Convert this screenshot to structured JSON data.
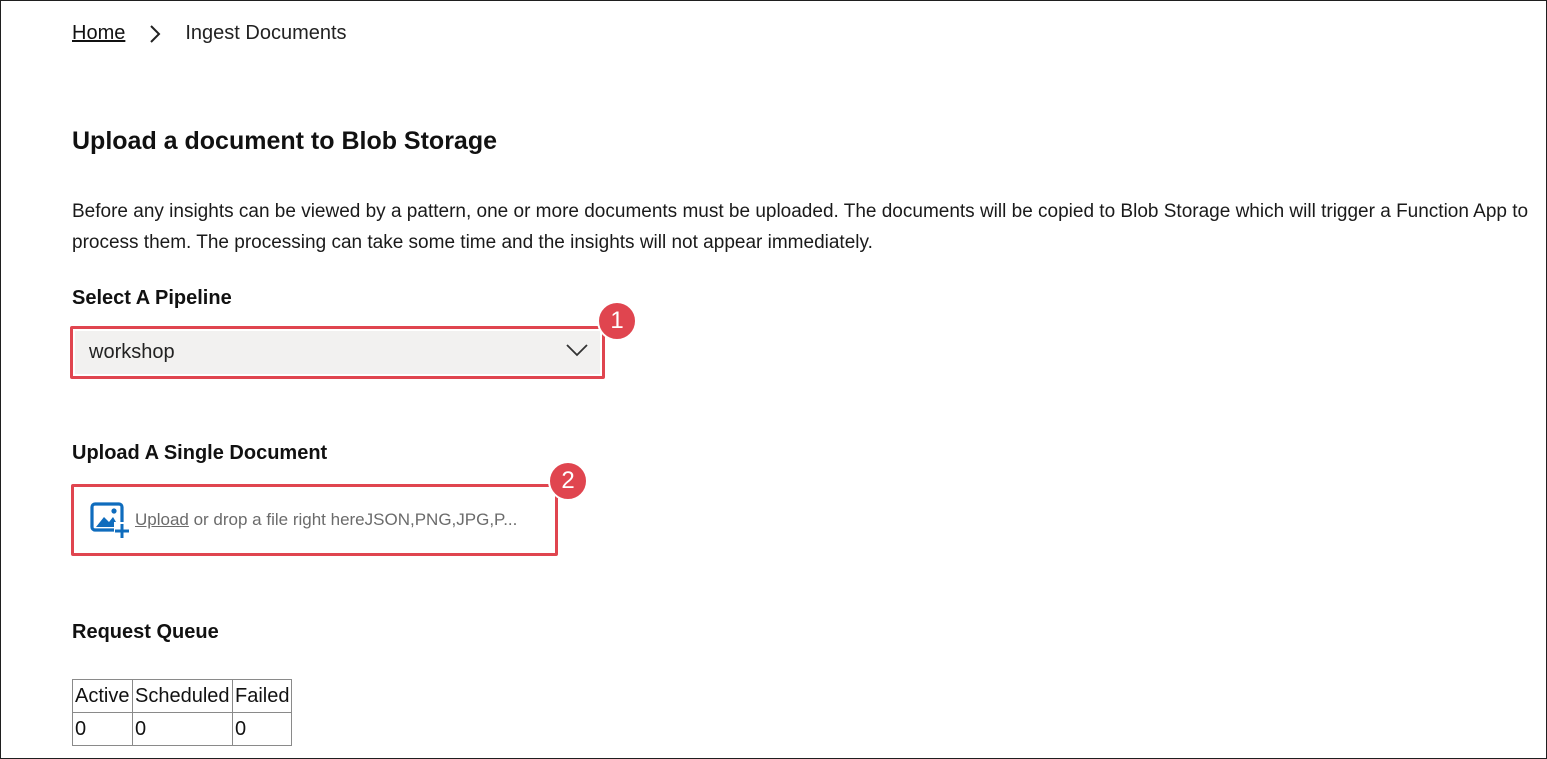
{
  "breadcrumb": {
    "home": "Home",
    "separator_icon": "chevron-right-icon",
    "current": "Ingest Documents"
  },
  "page": {
    "title": "Upload a document to Blob Storage",
    "description": "Before any insights can be viewed by a pattern, one or more documents must be uploaded. The documents will be copied to Blob Storage which will trigger a Function App to process them. The processing can take some time and the insights will not appear immediately."
  },
  "pipeline": {
    "label": "Select A Pipeline",
    "selected": "workshop",
    "icon": "chevron-down-icon"
  },
  "upload": {
    "label": "Upload A Single Document",
    "link_text": "Upload",
    "drop_text": " or drop a file right hereJSON,PNG,JPG,P...",
    "icon": "image-add-icon"
  },
  "annotations": {
    "badge_1": "1",
    "badge_2": "2",
    "highlight_color": "#e0454f"
  },
  "queue": {
    "label": "Request Queue",
    "columns": [
      "Active",
      "Scheduled",
      "Failed"
    ],
    "values": [
      "0",
      "0",
      "0"
    ]
  },
  "colors": {
    "accent_blue": "#0f6cbd",
    "select_bg": "#f2f1f0"
  }
}
